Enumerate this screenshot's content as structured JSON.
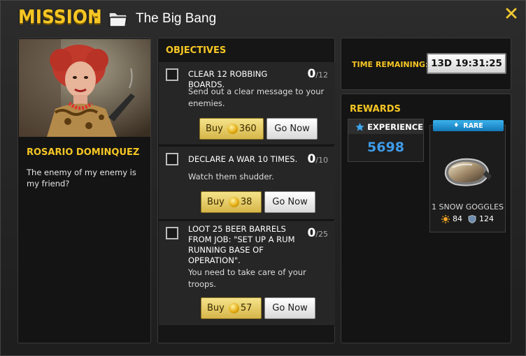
{
  "header": {
    "title_word": "MISSION",
    "title_colon": ":",
    "mission_name": "The Big Bang",
    "folder_icon": "folder-icon",
    "close_icon": "close-icon"
  },
  "character": {
    "name": "ROSARIO DOMINQUEZ",
    "quote": "The enemy of my enemy is my friend?"
  },
  "objectives": {
    "title": "OBJECTIVES",
    "items": [
      {
        "name": "CLEAR 12 ROBBING BOARDS.",
        "description": "Send out a clear message to your enemies.",
        "progress": "0",
        "total": "/12",
        "buy_label": "Buy",
        "price": "360",
        "go_label": "Go Now"
      },
      {
        "name": "DECLARE A WAR 10 TIMES.",
        "description": "Watch them shudder.",
        "progress": "0",
        "total": "/10",
        "buy_label": "Buy",
        "price": "38",
        "go_label": "Go Now"
      },
      {
        "name": "LOOT 25 BEER BARRELS FROM JOB: \"SET UP A RUM RUNNING BASE OF OPERATION\".",
        "description": "You need to take care of your troops.",
        "progress": "0",
        "total": "/25",
        "buy_label": "Buy",
        "price": "57",
        "go_label": "Go Now"
      }
    ]
  },
  "timer": {
    "label": "TIME REMAINING:",
    "value": "13D 19:31:25"
  },
  "rewards": {
    "title": "REWARDS",
    "experience_label": "EXPERIENCE",
    "experience_value": "5698",
    "item": {
      "badge": "RARE",
      "name": "1 SNOW GOGGLES",
      "attack": "84",
      "defense": "124"
    }
  },
  "colors": {
    "accent": "#f6c624",
    "exp_blue": "#3e9ce8",
    "rare_blue": "#1e8fd0"
  }
}
